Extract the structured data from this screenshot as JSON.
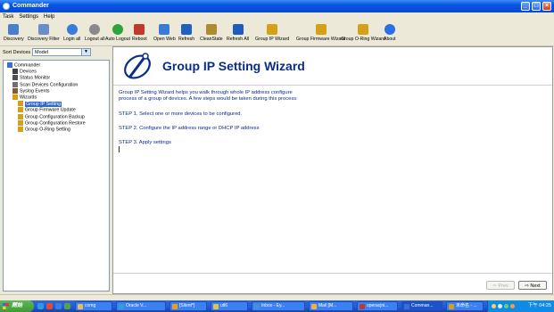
{
  "window": {
    "title": "Commander"
  },
  "menu": [
    "Task",
    "Settings",
    "Help"
  ],
  "toolbar": [
    {
      "label": "Discovery",
      "icon": "magnifier-icon",
      "color": "#4a7fd0"
    },
    {
      "label": "Discovery Filter",
      "icon": "filter-magnifier-icon",
      "color": "#6a8ec8"
    },
    {
      "label": "Login all",
      "icon": "user-icon",
      "color": "#3a7ad8"
    },
    {
      "label": "Logout all",
      "icon": "user-gray-icon",
      "color": "#8a8a8a"
    },
    {
      "label": "Auto Logout",
      "icon": "user-green-icon",
      "color": "#2ea33a"
    },
    {
      "label": "Reboot",
      "icon": "reboot-icon",
      "color": "#c0392b"
    },
    {
      "label": "Open Web",
      "icon": "web-page-icon",
      "color": "#3a7ad8"
    },
    {
      "label": "Refresh",
      "icon": "refresh-icon",
      "color": "#2060c0"
    },
    {
      "label": "CleanState",
      "icon": "broom-icon",
      "color": "#b08a30"
    },
    {
      "label": "Refresh All",
      "icon": "refresh-all-icon",
      "color": "#1e5bc0"
    },
    {
      "label": "Group IP Wizard",
      "icon": "wand-icon",
      "color": "#d4a017"
    },
    {
      "label": "Group Firmware Wizard",
      "icon": "wand-icon",
      "color": "#d4a017"
    },
    {
      "label": "Group O-Ring Wizard",
      "icon": "wand-icon",
      "color": "#d4a017"
    },
    {
      "label": "About",
      "icon": "info-icon",
      "color": "#2a6fe6"
    }
  ],
  "sidebar": {
    "sort_label": "Sort Devices By:",
    "sort_value": "Model",
    "tree": [
      {
        "label": "Commander",
        "level": 0,
        "icon": "commander-icon",
        "color": "#3a6fd0",
        "expanded": true
      },
      {
        "label": "Devices",
        "level": 1,
        "icon": "devices-icon",
        "color": "#404040"
      },
      {
        "label": "Status Monitor",
        "level": 1,
        "icon": "monitor-icon",
        "color": "#505050"
      },
      {
        "label": "Scan Devices Configuration",
        "level": 1,
        "icon": "scan-icon",
        "color": "#707070"
      },
      {
        "label": "Syslog Events",
        "level": 1,
        "icon": "syslog-icon",
        "color": "#8b5a2b"
      },
      {
        "label": "Wizards",
        "level": 1,
        "icon": "wand-icon",
        "color": "#d4a017",
        "expanded": true
      },
      {
        "label": "Group IP Setting",
        "level": 2,
        "icon": "wand-icon",
        "color": "#d4a017",
        "selected": true
      },
      {
        "label": "Group Firmware Update",
        "level": 2,
        "icon": "wand-icon",
        "color": "#d4a017"
      },
      {
        "label": "Group Configuration Backup",
        "level": 2,
        "icon": "wand-icon",
        "color": "#d4a017"
      },
      {
        "label": "Group Configuration Restore",
        "level": 2,
        "icon": "wand-icon",
        "color": "#d4a017"
      },
      {
        "label": "Group O-Ring Setting",
        "level": 2,
        "icon": "wand-icon",
        "color": "#d4a017"
      }
    ]
  },
  "wizard": {
    "title": "Group IP Setting Wizard",
    "intro_line1": "Group IP Setting Wizard helps you walk through whole IP address configure",
    "intro_line2": "process of a group of devices. A few steps would be taken during this process:",
    "step1": "STEP 1. Select one or more devices to be configured.",
    "step2": "STEP 2. Configure the IP address range or DHCP IP address",
    "step3": "STEP 3. Apply settings",
    "prev_label": "Prev",
    "next_label": "Next"
  },
  "taskbar": {
    "start_label": "開始",
    "tasks": [
      {
        "label": "comg",
        "color": "#e8c14a"
      },
      {
        "label": "Oracle V...",
        "color": "#3a9bd8"
      },
      {
        "label": "[Silent*]",
        "color": "#f39c12"
      },
      {
        "label": "utl6",
        "color": "#e8c14a"
      },
      {
        "label": "Inbox - Ey...",
        "color": "#4a90d9"
      },
      {
        "label": "Mail [M...",
        "color": "#f5b041"
      },
      {
        "label": "operacjni...",
        "color": "#c0392b"
      },
      {
        "label": "Comman...",
        "color": "#3a6fd0",
        "active": true
      },
      {
        "label": "未命名 - ...",
        "color": "#d4a017"
      }
    ],
    "clock": "下午 04:25"
  },
  "colors": {
    "accent": "#0a2c8a",
    "titlebar": "#0854e3",
    "selected": "#316ac5"
  }
}
